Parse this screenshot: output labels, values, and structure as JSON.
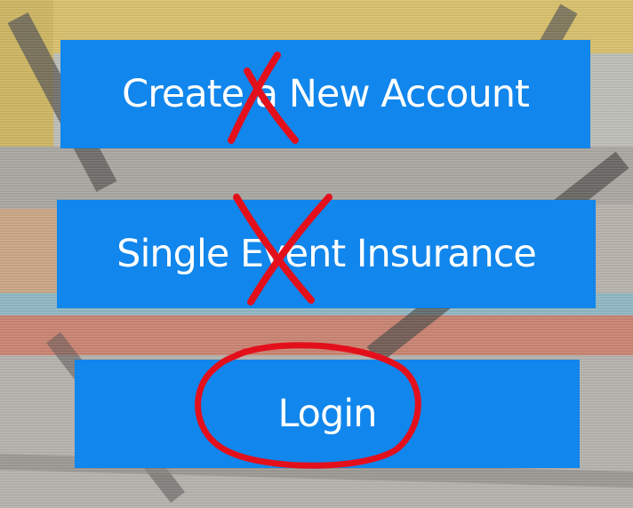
{
  "buttons": {
    "create_account": "Create a New Account",
    "single_event_insurance": "Single Event Insurance",
    "login": "Login"
  },
  "colors": {
    "button_blue": "#1186ec",
    "annotation_red": "#e3101c"
  },
  "annotations": [
    {
      "type": "cross",
      "target": "create_account"
    },
    {
      "type": "cross",
      "target": "single_event_insurance"
    },
    {
      "type": "circle",
      "target": "login"
    }
  ]
}
